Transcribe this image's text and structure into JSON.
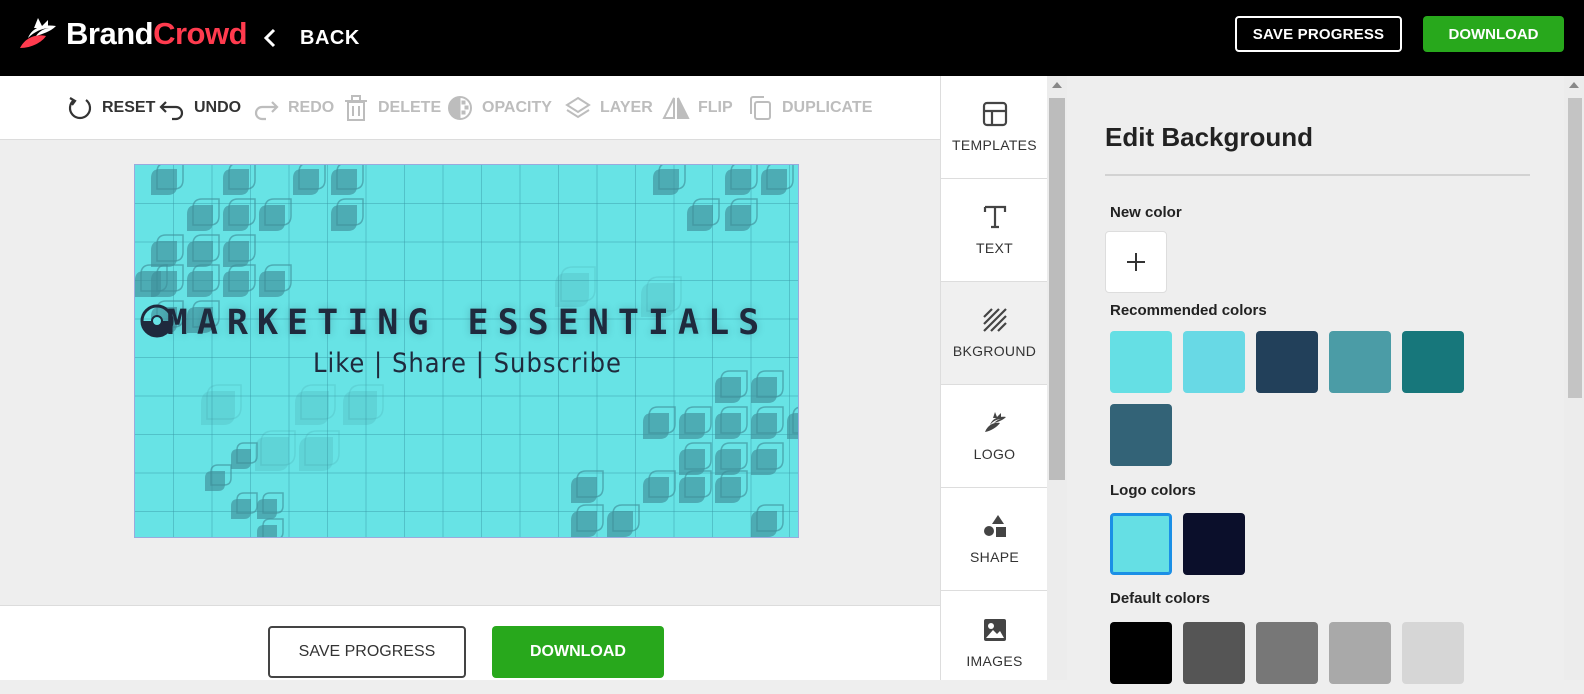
{
  "header": {
    "logo_brand": "Brand",
    "logo_crowd": "Crowd",
    "back_label": "BACK",
    "save_progress": "SAVE PROGRESS",
    "download": "DOWNLOAD"
  },
  "toolbar": {
    "reset": "RESET",
    "undo": "UNDO",
    "redo": "REDO",
    "delete": "DELETE",
    "opacity": "OPACITY",
    "layer": "LAYER",
    "flip": "FLIP",
    "duplicate": "DUPLICATE"
  },
  "design": {
    "title_left": "MARKETING",
    "title_right": "ESSENTIALS",
    "subtitle": "Like | Share | Subscribe",
    "background_color": "#67e3e5",
    "shape_color": "#3f8f9a"
  },
  "bottom": {
    "save_progress": "SAVE PROGRESS",
    "download": "DOWNLOAD"
  },
  "side_nav": {
    "items": [
      {
        "label": "TEMPLATES",
        "icon": "templates-icon"
      },
      {
        "label": "TEXT",
        "icon": "text-icon"
      },
      {
        "label": "BKGROUND",
        "icon": "background-icon"
      },
      {
        "label": "LOGO",
        "icon": "logo-icon"
      },
      {
        "label": "SHAPE",
        "icon": "shape-icon"
      },
      {
        "label": "IMAGES",
        "icon": "images-icon"
      }
    ],
    "active": "BKGROUND"
  },
  "panel": {
    "title": "Edit Background",
    "new_color": "New color",
    "recommended_label": "Recommended colors",
    "recommended": [
      "#65dfe4",
      "#68d9e5",
      "#22405a",
      "#4b9ca6",
      "#17777b",
      "#336377"
    ],
    "logo_label": "Logo colors",
    "logo_colors": [
      "#65dfe4",
      "#0b0f2b"
    ],
    "logo_selected": 0,
    "default_label": "Default colors",
    "default_colors": [
      "#000000",
      "#555555",
      "#777777",
      "#a9a9a9",
      "#d6d6d6"
    ]
  }
}
